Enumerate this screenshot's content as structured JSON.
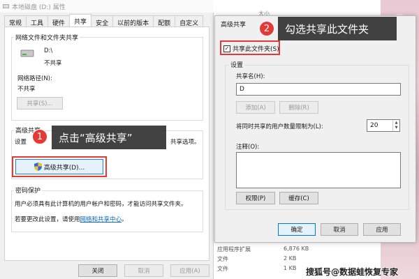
{
  "background": {
    "col_header": "大小",
    "rows": [
      {
        "name": "应用程序扩展",
        "size": "6,876 KB"
      },
      {
        "name": "文件",
        "size": "2 KB"
      },
      {
        "name": "文件",
        "size": "1 KB"
      }
    ]
  },
  "props_window": {
    "title": "本地磁盘 (D:) 属性",
    "tabs": [
      "常规",
      "工具",
      "硬件",
      "共享",
      "安全",
      "以前的版本",
      "配额",
      "自定义"
    ],
    "active_tab": "共享",
    "net_share": {
      "heading": "网络文件和文件夹共享",
      "drive_name": "D:\\",
      "drive_state": "不共享",
      "path_label": "网络路径(N):",
      "path_value": "不共享",
      "share_button": "共享(S)..."
    },
    "advanced": {
      "heading": "高级共享",
      "desc_start": "设置",
      "desc_end": "共享选项。",
      "button": "高级共享(D)..."
    },
    "password": {
      "heading": "密码保护",
      "desc": "用户必须具有此计算机的用户帐户和密码，才能访问共享文件夹。",
      "change_prefix": "若要更改此设置，请使用",
      "change_link": "网络和共享中心",
      "change_suffix": "。"
    },
    "buttons": {
      "close": "关闭",
      "cancel": "取消",
      "apply": "应用(A)"
    }
  },
  "adv_dialog": {
    "title": "高级共享",
    "share_checkbox": {
      "label": "共享此文件夹(S)",
      "checked": true
    },
    "settings_label": "设置",
    "share_name_label": "共享名(H):",
    "share_name_value": "D",
    "add_button": "添加(A)",
    "remove_button": "删除(R)",
    "limit_label": "将同时共享的用户数量限制为(L):",
    "limit_value": "20",
    "comment_label": "注释(O):",
    "permissions_button": "权限(P)",
    "caching_button": "缓存(C)",
    "ok_button": "确定",
    "cancel_button": "取消",
    "apply_button": "应用"
  },
  "callouts": [
    {
      "number": "1",
      "text": "点击“高级共享”"
    },
    {
      "number": "2",
      "text": "勾选共享此文件夹"
    }
  ],
  "watermark": "搜狐号@数据蛙恢复专家"
}
